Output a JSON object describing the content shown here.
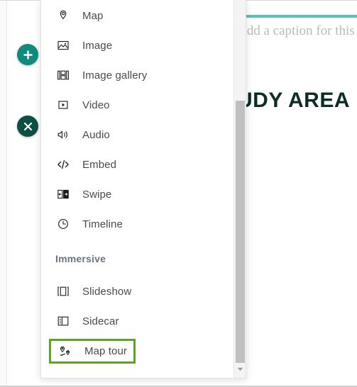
{
  "story": {
    "caption_placeholder": "Add a caption for this",
    "heading": "UDY AREA"
  },
  "toolbar": {
    "add_label": "+",
    "close_label": "×"
  },
  "panel": {
    "sections": [
      {
        "heading": "",
        "items": [
          {
            "label": "Map",
            "icon": "map-pin-icon",
            "highlighted": false
          },
          {
            "label": "Image",
            "icon": "image-icon",
            "highlighted": false
          },
          {
            "label": "Image gallery",
            "icon": "image-gallery-icon",
            "highlighted": false
          },
          {
            "label": "Video",
            "icon": "video-icon",
            "highlighted": false
          },
          {
            "label": "Audio",
            "icon": "audio-icon",
            "highlighted": false
          },
          {
            "label": "Embed",
            "icon": "embed-code-icon",
            "highlighted": false
          },
          {
            "label": "Swipe",
            "icon": "swipe-icon",
            "highlighted": false
          },
          {
            "label": "Timeline",
            "icon": "timeline-clock-icon",
            "highlighted": false
          }
        ]
      },
      {
        "heading": "Immersive",
        "items": [
          {
            "label": "Slideshow",
            "icon": "slideshow-icon",
            "highlighted": false
          },
          {
            "label": "Sidecar",
            "icon": "sidecar-icon",
            "highlighted": false
          },
          {
            "label": "Map tour",
            "icon": "map-tour-icon",
            "highlighted": true
          }
        ]
      }
    ]
  },
  "scrollbar": {
    "down_arrow": "chevron-down-icon"
  },
  "colors": {
    "add_button": "#0f8a7c",
    "close_button": "#0c4f45",
    "highlight_outline": "#5ba522",
    "accent_bar": "#5cc0b8",
    "heading_text": "#0d2c28",
    "group_heading_text": "#6a7480"
  }
}
